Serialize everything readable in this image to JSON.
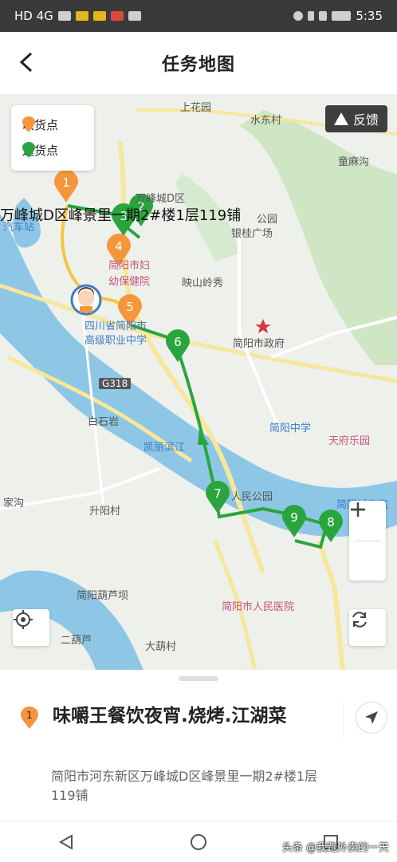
{
  "status_bar": {
    "left": "HD 4G",
    "time": "5:35"
  },
  "header": {
    "title": "任务地图"
  },
  "legend": {
    "pickup": "取货点",
    "delivery": "送货点"
  },
  "feedback": {
    "label": "反馈"
  },
  "colors": {
    "pickup": "#f5963c",
    "delivery": "#2aa53e",
    "route": "#2aa53e",
    "river": "#8ec7e6"
  },
  "map": {
    "labels": {
      "shanghuayuan": "上花园",
      "shuidongcun": "水东村",
      "tongmagou": "童麻沟",
      "wanfengcheng": "万峰城D区",
      "overlay": "万峰城D区峰景里一期2#楼1层119铺",
      "qichezhan": "汽车站",
      "gongyuan": "公园",
      "yinguiguangchang": "银桂广场",
      "fuyou1": "简阳市妇",
      "fuyou2": "幼保健院",
      "yingshan": "映山岭秀",
      "zhiye1": "四川省简阳市",
      "zhiye2": "高级职业中学",
      "zhengfu": "简阳市政府",
      "g318": "G318",
      "baishiyan": "白石岩",
      "kailibinjiang": "凯丽滨江",
      "jianyangzhongxue": "简阳中学",
      "tianfuleyuan": "天府乐园",
      "jiagou": "家沟",
      "renmingongyuan": "人民公园",
      "jianyangchengdong": "简阳城东汽",
      "shengyangcun": "升阳村",
      "huluba": "简阳葫芦坝",
      "yiyuan": "简阳市人民医院",
      "erhulu": "二葫芦",
      "dahucun": "大葫村"
    },
    "pickup_markers": [
      "1",
      "4",
      "5"
    ],
    "delivery_markers": [
      "2",
      "3",
      "6",
      "7",
      "8",
      "9"
    ]
  },
  "task": {
    "index": "1",
    "shop_name": "味嚼王餐饮夜宵.烧烤.江湖菜",
    "address": "简阳市河东新区万峰城D区峰景里一期2#楼1层119铺"
  },
  "watermark": "头条 @我跑外卖的一天"
}
